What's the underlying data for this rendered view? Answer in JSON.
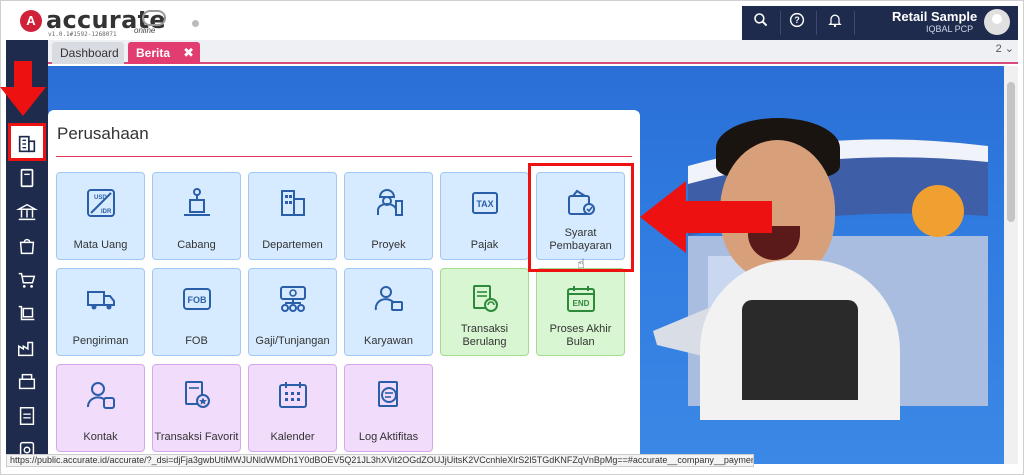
{
  "app": {
    "logo_text": "accurate",
    "logo_sub": "online",
    "version": "v1.0.1#1592-1268071"
  },
  "header": {
    "company": "Retail Sample",
    "user": "IQBAL PCP",
    "icons": [
      "search-icon",
      "help-icon",
      "bell-icon",
      "chevron-down-icon",
      "avatar"
    ]
  },
  "tabs": [
    {
      "label": "Dashboard",
      "active": false
    },
    {
      "label": "Berita",
      "active": true,
      "close": "✖"
    }
  ],
  "tab_count": "2 ⌄",
  "panel": {
    "title": "Perusahaan",
    "tiles": [
      {
        "label": "Mata Uang",
        "icon": "currency-icon",
        "color": "blue"
      },
      {
        "label": "Cabang",
        "icon": "branch-icon",
        "color": "blue"
      },
      {
        "label": "Departemen",
        "icon": "department-icon",
        "color": "blue"
      },
      {
        "label": "Proyek",
        "icon": "project-icon",
        "color": "blue"
      },
      {
        "label": "Pajak",
        "icon": "tax-icon",
        "color": "blue"
      },
      {
        "label": "Syarat Pembayaran",
        "icon": "payment-term-icon",
        "color": "blue"
      },
      {
        "label": "Pengiriman",
        "icon": "truck-icon",
        "color": "blue"
      },
      {
        "label": "FOB",
        "icon": "fob-icon",
        "color": "blue"
      },
      {
        "label": "Gaji/Tunjangan",
        "icon": "salary-icon",
        "color": "blue"
      },
      {
        "label": "Karyawan",
        "icon": "employee-icon",
        "color": "blue"
      },
      {
        "label": "Transaksi Berulang",
        "icon": "recurring-icon",
        "color": "green"
      },
      {
        "label": "Proses Akhir Bulan",
        "icon": "end-month-icon",
        "color": "green"
      },
      {
        "label": "Kontak",
        "icon": "contact-icon",
        "color": "purple"
      },
      {
        "label": "Transaksi Favorit",
        "icon": "favorite-icon",
        "color": "purple"
      },
      {
        "label": "Kalender",
        "icon": "calendar-icon",
        "color": "purple"
      },
      {
        "label": "Log Aktifitas",
        "icon": "log-icon",
        "color": "purple"
      }
    ]
  },
  "statusbar": {
    "url": "https://public.accurate.id/accurate/?_dsi=djFja3gwbUtiMWJUNldWMDh1Y0dBOEV5Q21JL3hXVit2OGdZOUJjUitsK2VCcnhleXlrS2I5TGdKNFZqVnBpMg==#accurate__company__payment-term"
  },
  "colors": {
    "navy": "#1e2b4c",
    "accent": "#e23d70",
    "highlight": "#ee1111"
  }
}
